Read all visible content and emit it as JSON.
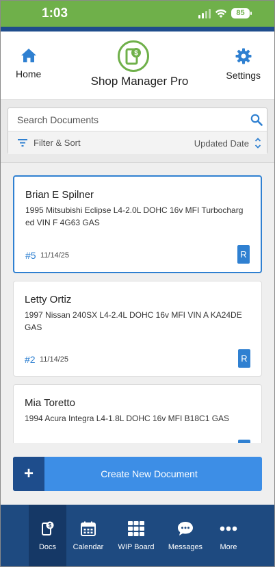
{
  "status_bar": {
    "time": "1:03",
    "battery": "85"
  },
  "header": {
    "home_label": "Home",
    "settings_label": "Settings",
    "title": "Shop Manager Pro",
    "logo_symbol": "$"
  },
  "search": {
    "placeholder": "Search Documents",
    "filter_label": "Filter & Sort",
    "sort_label": "Updated Date"
  },
  "documents": [
    {
      "name": "Brian E Spilner",
      "vehicle": "1995 Mitsubishi Eclipse L4-2.0L DOHC 16v MFI Turbocharged VIN F 4G63 GAS",
      "number": "#5",
      "date": "11/14/25",
      "badge": "R"
    },
    {
      "name": "Letty Ortiz",
      "vehicle": "1997 Nissan 240SX L4-2.4L DOHC 16v MFI VIN A KA24DE GAS",
      "number": "#2",
      "date": "11/14/25",
      "badge": "R"
    },
    {
      "name": "Mia Toretto",
      "vehicle": "1994 Acura Integra L4-1.8L DOHC 16v MFI B18C1 GAS",
      "number": "",
      "date": "",
      "badge": ""
    }
  ],
  "create_button": {
    "plus": "+",
    "label": "Create New Document"
  },
  "tabs": [
    {
      "label": "Docs",
      "icon": "docs-icon",
      "active": true
    },
    {
      "label": "Calendar",
      "icon": "calendar-icon",
      "active": false
    },
    {
      "label": "WIP Board",
      "icon": "grid-icon",
      "active": false
    },
    {
      "label": "Messages",
      "icon": "chat-icon",
      "active": false
    },
    {
      "label": "More",
      "icon": "more-icon",
      "active": false
    }
  ],
  "colors": {
    "brand_green": "#6fb04a",
    "navy": "#1e4d8c",
    "accent_blue": "#2f80d1",
    "button_blue": "#3d8ee6"
  }
}
